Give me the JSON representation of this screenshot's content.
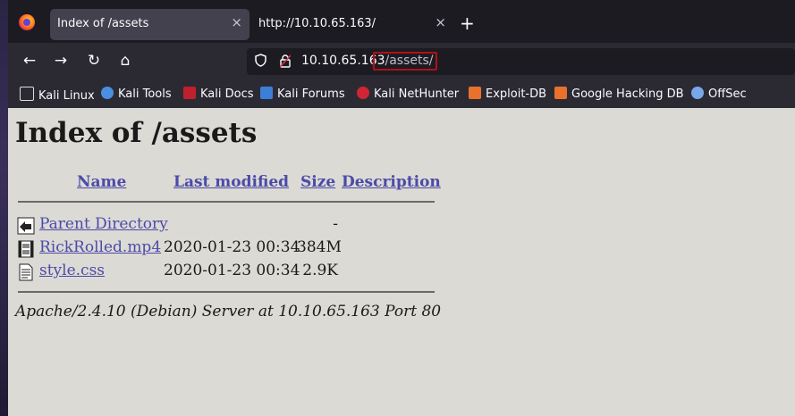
{
  "browser": {
    "tabs": [
      {
        "title": "Index of /assets",
        "active": true
      },
      {
        "title": "http://10.10.65.163/",
        "active": false
      }
    ],
    "new_tab": "+",
    "close_glyph": "×",
    "nav": {
      "back": "←",
      "forward": "→",
      "reload": "↻",
      "home": "⌂"
    },
    "url": {
      "host": "10.10.65.163",
      "path": "/assets/",
      "highlight_color": "#b0101a"
    },
    "bookmarks": [
      {
        "label": "Kali Linux",
        "icon": "kali-dragon-icon"
      },
      {
        "label": "Kali Tools",
        "icon": "kali-tools-icon"
      },
      {
        "label": "Kali Docs",
        "icon": "kali-docs-icon"
      },
      {
        "label": "Kali Forums",
        "icon": "kali-forums-icon"
      },
      {
        "label": "Kali NetHunter",
        "icon": "nethunter-icon"
      },
      {
        "label": "Exploit-DB",
        "icon": "exploit-db-icon"
      },
      {
        "label": "Google Hacking DB",
        "icon": "ghdb-icon"
      },
      {
        "label": "OffSec",
        "icon": "offsec-icon"
      }
    ]
  },
  "page": {
    "title": "Index of /assets",
    "columns": {
      "name": "Name",
      "modified": "Last modified",
      "size": "Size",
      "description": "Description"
    },
    "rows": [
      {
        "name": "Parent Directory",
        "modified": "",
        "size": "-",
        "icon": "back-arrow-icon"
      },
      {
        "name": "RickRolled.mp4",
        "modified": "2020-01-23 00:34",
        "size": "384M",
        "icon": "video-file-icon"
      },
      {
        "name": "style.css",
        "modified": "2020-01-23 00:34",
        "size": "2.9K",
        "icon": "text-file-icon"
      }
    ],
    "footer": "Apache/2.4.10 (Debian) Server at 10.10.65.163 Port 80"
  },
  "colors": {
    "link": "#4b4ba8",
    "page_bg": "#dcdad5",
    "chrome_bg": "#1c1b22",
    "toolbar_bg": "#2b2a33"
  }
}
